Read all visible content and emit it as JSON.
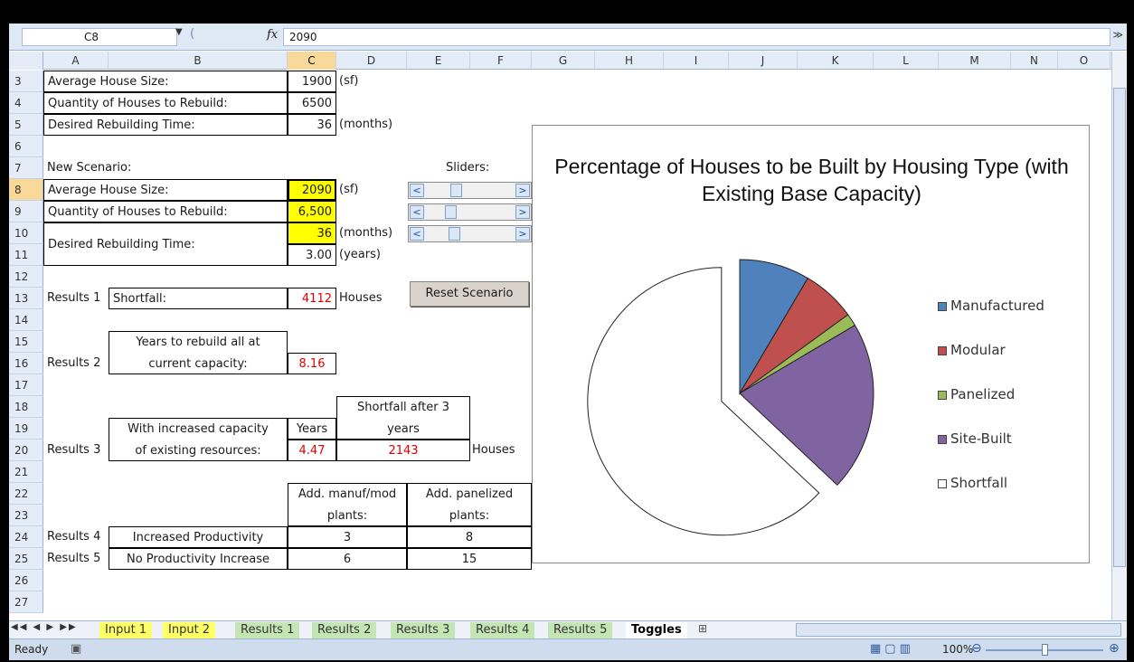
{
  "formula_bar": {
    "name_box": "C8",
    "fx": "fx",
    "value": "2090"
  },
  "columns": [
    "A",
    "B",
    "C",
    "D",
    "E",
    "F",
    "G",
    "H",
    "I",
    "J",
    "K",
    "L",
    "M",
    "N",
    "O"
  ],
  "rows": [
    "3",
    "4",
    "5",
    "6",
    "7",
    "8",
    "9",
    "10",
    "11",
    "12",
    "13",
    "14",
    "15",
    "16",
    "17",
    "18",
    "19",
    "20",
    "21",
    "22",
    "23",
    "24",
    "25",
    "26",
    "27"
  ],
  "cells": {
    "b3": "Average House Size:",
    "c3": "1900",
    "d3": "(sf)",
    "b4": "Quantity of Houses to Rebuild:",
    "c4": "6500",
    "b5": "Desired Rebuilding Time:",
    "c5": "36",
    "d5": "(months)",
    "a7": "New Scenario:",
    "e7": "Sliders:",
    "b8": "Average House Size:",
    "c8": "2090",
    "d8": "(sf)",
    "b9": "Quantity of Houses to Rebuild:",
    "c9": "6,500",
    "b10": "Desired Rebuilding Time:",
    "c10": "36",
    "d10": "(months)",
    "c11": "3.00",
    "d11": "(years)",
    "a13": "Results 1",
    "b13": "Shortfall:",
    "c13": "4112",
    "d13": "Houses",
    "b15": "Years to rebuild all at",
    "a16": "Results 2",
    "b16": "current capacity:",
    "c16": "8.16",
    "d18": "Shortfall after 3",
    "b19": "With increased capacity",
    "c19": "Years",
    "d19": "years",
    "a20": "Results 3",
    "b20": "of existing resources:",
    "c20": "4.47",
    "d20": "2143",
    "f20": "Houses",
    "c22": "Add. manuf/mod",
    "e22": "Add. panelized",
    "c23": "plants:",
    "e23": "plants:",
    "a24": "Results 4",
    "b24": "Increased Productivity",
    "c24": "3",
    "e24": "8",
    "a25": "Results 5",
    "b25": "No Productivity Increase",
    "c25": "6",
    "e25": "15"
  },
  "slider_arrows": {
    "left": "<",
    "right": ">"
  },
  "reset_button": "Reset Scenario",
  "chart_data": {
    "type": "pie",
    "title": "Percentage of Houses to be Built by Housing Type (with Existing Base Capacity)",
    "categories": [
      "Manufactured",
      "Modular",
      "Panelized",
      "Site-Built",
      "Shortfall"
    ],
    "values": [
      8.5,
      6.5,
      1.5,
      20.5,
      63.0
    ],
    "colors": [
      "#4f81bd",
      "#c0504d",
      "#9bbb59",
      "#8064a2",
      "#ffffff"
    ],
    "exploded": "Shortfall",
    "legend": "right"
  },
  "tabs": [
    "Input 1",
    "Input 2",
    "Results 1",
    "Results 2",
    "Results 3",
    "Results 4",
    "Results 5",
    "Toggles"
  ],
  "tab_colors": [
    "yellow",
    "yellow",
    "green",
    "green",
    "green",
    "green",
    "green",
    "active"
  ],
  "status": {
    "text": "Ready",
    "zoom": "100%"
  }
}
